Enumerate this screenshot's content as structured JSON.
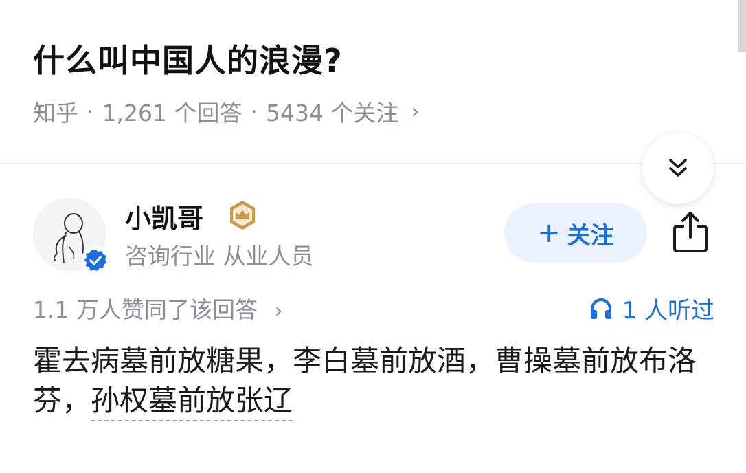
{
  "question": {
    "title": "什么叫中国人的浪漫?"
  },
  "meta": {
    "source": "知乎",
    "separator": "·",
    "answers": "1,261 个回答",
    "followers": "5434 个关注",
    "chevron": "›"
  },
  "author": {
    "name": "小凯哥",
    "bio": "咨询行业 从业人员",
    "avatar_icon": "sketch-figure-avatar",
    "badges": [
      "verified-badge-icon",
      "crown-badge-icon"
    ]
  },
  "actions": {
    "follow_plus": "+",
    "follow_label": "关注",
    "share_icon": "share-icon",
    "collapse_icon": "double-chevron-down-icon"
  },
  "answer": {
    "votes": "1.1 万人赞同了该回答",
    "votes_chevron": "›",
    "listened": "1 人听过",
    "listened_icon": "headphones-icon",
    "text_main": "霍去病墓前放糖果，李白墓前放酒，曹操墓前放布洛芬，",
    "text_link": "孙权墓前放张辽"
  },
  "colors": {
    "accent_blue": "#1a6fe0",
    "follow_bg": "#ebf2fd",
    "meta_gray": "#8a8f99",
    "crown_gold": "#c99a4b"
  }
}
